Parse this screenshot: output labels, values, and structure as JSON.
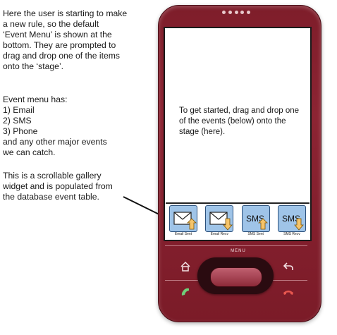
{
  "annotations": {
    "intro": [
      "Here the user is starting to make",
      "a new rule, so the default",
      "‘Event Menu’ is shown at the",
      "bottom. They are prompted to",
      "drag and drop one of the items",
      "onto the ‘stage’."
    ],
    "event_menu": [
      "Event menu has:",
      "1) Email",
      "2) SMS",
      "3) Phone",
      "and any other major events",
      "we can catch."
    ],
    "gallery_note": [
      "This is a scrollable gallery",
      "widget and is populated from",
      "the database event table."
    ]
  },
  "screen": {
    "stage_message": "To get started, drag and drop one of the events (below) onto the stage (here)."
  },
  "gallery": {
    "items": [
      {
        "caption": "Email Sent",
        "icon": "envelope-icon",
        "arrow": "up"
      },
      {
        "caption": "Email Recv",
        "icon": "envelope-icon",
        "arrow": "down"
      },
      {
        "caption": "SMS Sent",
        "icon_text": "SMS",
        "arrow": "up"
      },
      {
        "caption": "SMS Recv",
        "icon_text": "SMS",
        "arrow": "down"
      }
    ]
  },
  "hardware": {
    "menu_label": "MENU",
    "buttons": [
      "home-icon",
      "back-icon",
      "call-icon",
      "end-call-icon"
    ]
  },
  "colors": {
    "phone_body": "#8c2433",
    "gallery_icon_fill": "#9fc4e8",
    "arrow_fill": "#f5c46a"
  }
}
